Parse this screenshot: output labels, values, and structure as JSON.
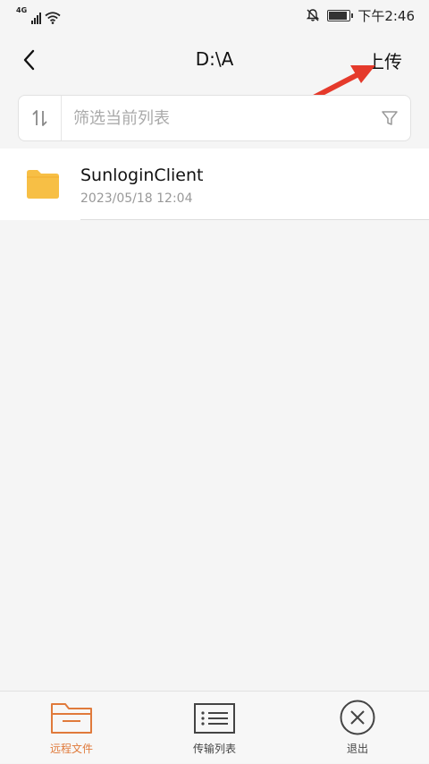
{
  "status_bar": {
    "network": "4G",
    "time": "下午2:46",
    "battery_level": 0.9
  },
  "header": {
    "title": "D:\\A",
    "upload_label": "上传",
    "back_icon": "chevron-left-icon"
  },
  "filter": {
    "placeholder": "筛选当前列表",
    "sort_icon": "sort-icon",
    "funnel_icon": "funnel-icon"
  },
  "files": [
    {
      "name": "SunloginClient",
      "date": "2023/05/18 12:04",
      "icon": "folder-icon"
    }
  ],
  "bottom_tabs": [
    {
      "label": "远程文件",
      "icon": "folder-outline-icon",
      "active": true
    },
    {
      "label": "传输列表",
      "icon": "list-icon",
      "active": false
    },
    {
      "label": "退出",
      "icon": "close-circle-icon",
      "active": false
    }
  ],
  "colors": {
    "accent": "#e07a3b",
    "folder": "#f7bf45",
    "annotation_arrow": "#e53a2b",
    "background": "#f5f5f5"
  }
}
